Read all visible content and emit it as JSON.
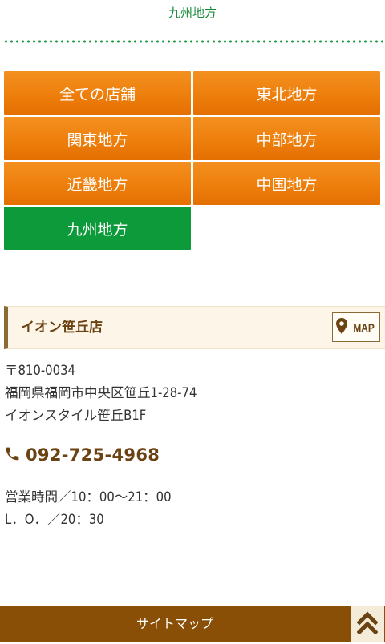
{
  "breadcrumb": {
    "current": "九州地方"
  },
  "regions": [
    {
      "label": "全ての店舗",
      "active": false
    },
    {
      "label": "東北地方",
      "active": false
    },
    {
      "label": "関東地方",
      "active": false
    },
    {
      "label": "中部地方",
      "active": false
    },
    {
      "label": "近畿地方",
      "active": false
    },
    {
      "label": "中国地方",
      "active": false
    },
    {
      "label": "九州地方",
      "active": true
    }
  ],
  "store": {
    "name": "イオン笹丘店",
    "map_label": "MAP",
    "postal": "〒810-0034",
    "address": "福岡県福岡市中央区笹丘1-28-74",
    "building": "イオンスタイル笹丘B1F",
    "phone": "092-725-4968",
    "hours": "営業時間／10：00〜21：00",
    "last_order": "L．O．／20：30"
  },
  "footer": {
    "sitemap_label": "サイトマップ"
  },
  "colors": {
    "orange": "#ee7f0c",
    "green": "#0d9a3a",
    "brown": "#8a4f06",
    "text_brown": "#6b4211"
  }
}
